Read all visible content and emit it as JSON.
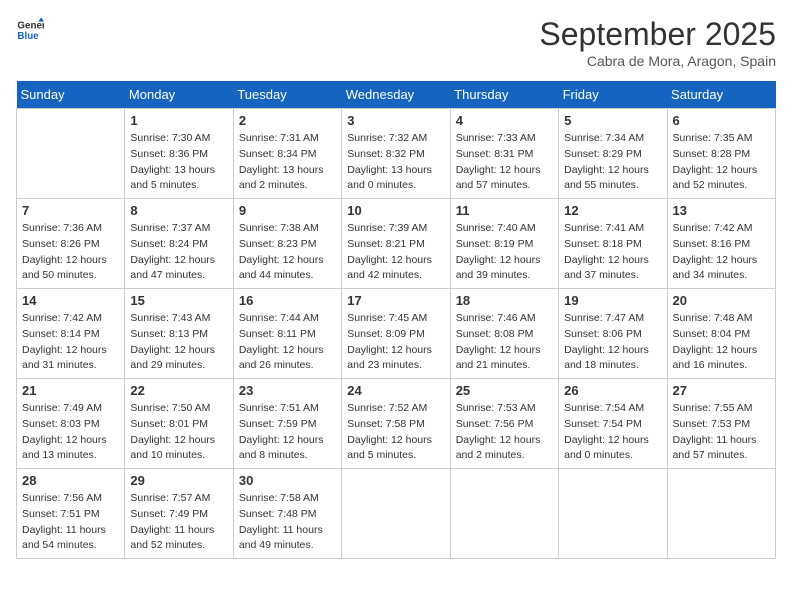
{
  "header": {
    "logo_line1": "General",
    "logo_line2": "Blue",
    "month_title": "September 2025",
    "subtitle": "Cabra de Mora, Aragon, Spain"
  },
  "days_of_week": [
    "Sunday",
    "Monday",
    "Tuesday",
    "Wednesday",
    "Thursday",
    "Friday",
    "Saturday"
  ],
  "weeks": [
    [
      {
        "day": "",
        "info": ""
      },
      {
        "day": "1",
        "info": "Sunrise: 7:30 AM\nSunset: 8:36 PM\nDaylight: 13 hours\nand 5 minutes."
      },
      {
        "day": "2",
        "info": "Sunrise: 7:31 AM\nSunset: 8:34 PM\nDaylight: 13 hours\nand 2 minutes."
      },
      {
        "day": "3",
        "info": "Sunrise: 7:32 AM\nSunset: 8:32 PM\nDaylight: 13 hours\nand 0 minutes."
      },
      {
        "day": "4",
        "info": "Sunrise: 7:33 AM\nSunset: 8:31 PM\nDaylight: 12 hours\nand 57 minutes."
      },
      {
        "day": "5",
        "info": "Sunrise: 7:34 AM\nSunset: 8:29 PM\nDaylight: 12 hours\nand 55 minutes."
      },
      {
        "day": "6",
        "info": "Sunrise: 7:35 AM\nSunset: 8:28 PM\nDaylight: 12 hours\nand 52 minutes."
      }
    ],
    [
      {
        "day": "7",
        "info": "Sunrise: 7:36 AM\nSunset: 8:26 PM\nDaylight: 12 hours\nand 50 minutes."
      },
      {
        "day": "8",
        "info": "Sunrise: 7:37 AM\nSunset: 8:24 PM\nDaylight: 12 hours\nand 47 minutes."
      },
      {
        "day": "9",
        "info": "Sunrise: 7:38 AM\nSunset: 8:23 PM\nDaylight: 12 hours\nand 44 minutes."
      },
      {
        "day": "10",
        "info": "Sunrise: 7:39 AM\nSunset: 8:21 PM\nDaylight: 12 hours\nand 42 minutes."
      },
      {
        "day": "11",
        "info": "Sunrise: 7:40 AM\nSunset: 8:19 PM\nDaylight: 12 hours\nand 39 minutes."
      },
      {
        "day": "12",
        "info": "Sunrise: 7:41 AM\nSunset: 8:18 PM\nDaylight: 12 hours\nand 37 minutes."
      },
      {
        "day": "13",
        "info": "Sunrise: 7:42 AM\nSunset: 8:16 PM\nDaylight: 12 hours\nand 34 minutes."
      }
    ],
    [
      {
        "day": "14",
        "info": "Sunrise: 7:42 AM\nSunset: 8:14 PM\nDaylight: 12 hours\nand 31 minutes."
      },
      {
        "day": "15",
        "info": "Sunrise: 7:43 AM\nSunset: 8:13 PM\nDaylight: 12 hours\nand 29 minutes."
      },
      {
        "day": "16",
        "info": "Sunrise: 7:44 AM\nSunset: 8:11 PM\nDaylight: 12 hours\nand 26 minutes."
      },
      {
        "day": "17",
        "info": "Sunrise: 7:45 AM\nSunset: 8:09 PM\nDaylight: 12 hours\nand 23 minutes."
      },
      {
        "day": "18",
        "info": "Sunrise: 7:46 AM\nSunset: 8:08 PM\nDaylight: 12 hours\nand 21 minutes."
      },
      {
        "day": "19",
        "info": "Sunrise: 7:47 AM\nSunset: 8:06 PM\nDaylight: 12 hours\nand 18 minutes."
      },
      {
        "day": "20",
        "info": "Sunrise: 7:48 AM\nSunset: 8:04 PM\nDaylight: 12 hours\nand 16 minutes."
      }
    ],
    [
      {
        "day": "21",
        "info": "Sunrise: 7:49 AM\nSunset: 8:03 PM\nDaylight: 12 hours\nand 13 minutes."
      },
      {
        "day": "22",
        "info": "Sunrise: 7:50 AM\nSunset: 8:01 PM\nDaylight: 12 hours\nand 10 minutes."
      },
      {
        "day": "23",
        "info": "Sunrise: 7:51 AM\nSunset: 7:59 PM\nDaylight: 12 hours\nand 8 minutes."
      },
      {
        "day": "24",
        "info": "Sunrise: 7:52 AM\nSunset: 7:58 PM\nDaylight: 12 hours\nand 5 minutes."
      },
      {
        "day": "25",
        "info": "Sunrise: 7:53 AM\nSunset: 7:56 PM\nDaylight: 12 hours\nand 2 minutes."
      },
      {
        "day": "26",
        "info": "Sunrise: 7:54 AM\nSunset: 7:54 PM\nDaylight: 12 hours\nand 0 minutes."
      },
      {
        "day": "27",
        "info": "Sunrise: 7:55 AM\nSunset: 7:53 PM\nDaylight: 11 hours\nand 57 minutes."
      }
    ],
    [
      {
        "day": "28",
        "info": "Sunrise: 7:56 AM\nSunset: 7:51 PM\nDaylight: 11 hours\nand 54 minutes."
      },
      {
        "day": "29",
        "info": "Sunrise: 7:57 AM\nSunset: 7:49 PM\nDaylight: 11 hours\nand 52 minutes."
      },
      {
        "day": "30",
        "info": "Sunrise: 7:58 AM\nSunset: 7:48 PM\nDaylight: 11 hours\nand 49 minutes."
      },
      {
        "day": "",
        "info": ""
      },
      {
        "day": "",
        "info": ""
      },
      {
        "day": "",
        "info": ""
      },
      {
        "day": "",
        "info": ""
      }
    ]
  ]
}
